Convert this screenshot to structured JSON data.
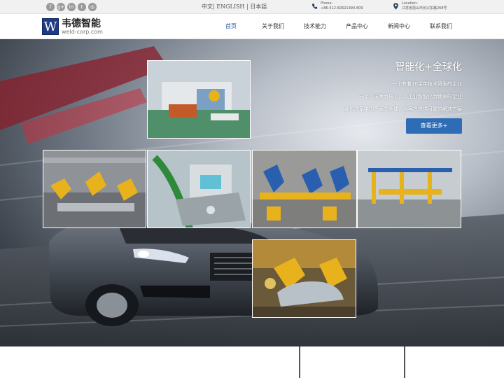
{
  "topbar": {
    "social_icons": [
      "facebook-icon",
      "google-plus-icon",
      "linkedin-icon",
      "twitter-icon",
      "instagram-icon"
    ],
    "social_glyphs": [
      "f",
      "g+",
      "in",
      "t",
      "◎"
    ],
    "langs": {
      "zh": "中文",
      "sep1": "|",
      "en": "ENGLISH",
      "sep2": "|",
      "ja": "日本語"
    },
    "phone_label": "Phone:",
    "phone_value": "+86-512-82621990-809",
    "location_label": "Location:",
    "location_value": "江苏省昆山市长兴东路268号"
  },
  "header": {
    "logo_mark": "W",
    "logo_name": "韦德智能",
    "logo_domain": "weld-corp.com",
    "nav": [
      "首页",
      "关于我们",
      "技术能力",
      "产品中心",
      "新闻中心",
      "联系我们"
    ],
    "active_index": 0
  },
  "hero": {
    "title": "智能化+全球化",
    "lines": [
      "一个有着10余年技术研发的企业",
      "一个以技术为核心，以工业智能化为使命的企业",
      "我们立足中国，面向全球，为客户提供可靠的解决方案"
    ],
    "more_button": "查看更多+"
  },
  "colors": {
    "brand_blue": "#1f3b85",
    "nav_active": "#1f4fa5",
    "button": "#2e6cb5",
    "robot_yellow": "#e7b21c",
    "robot_blue": "#2a5fb0"
  }
}
